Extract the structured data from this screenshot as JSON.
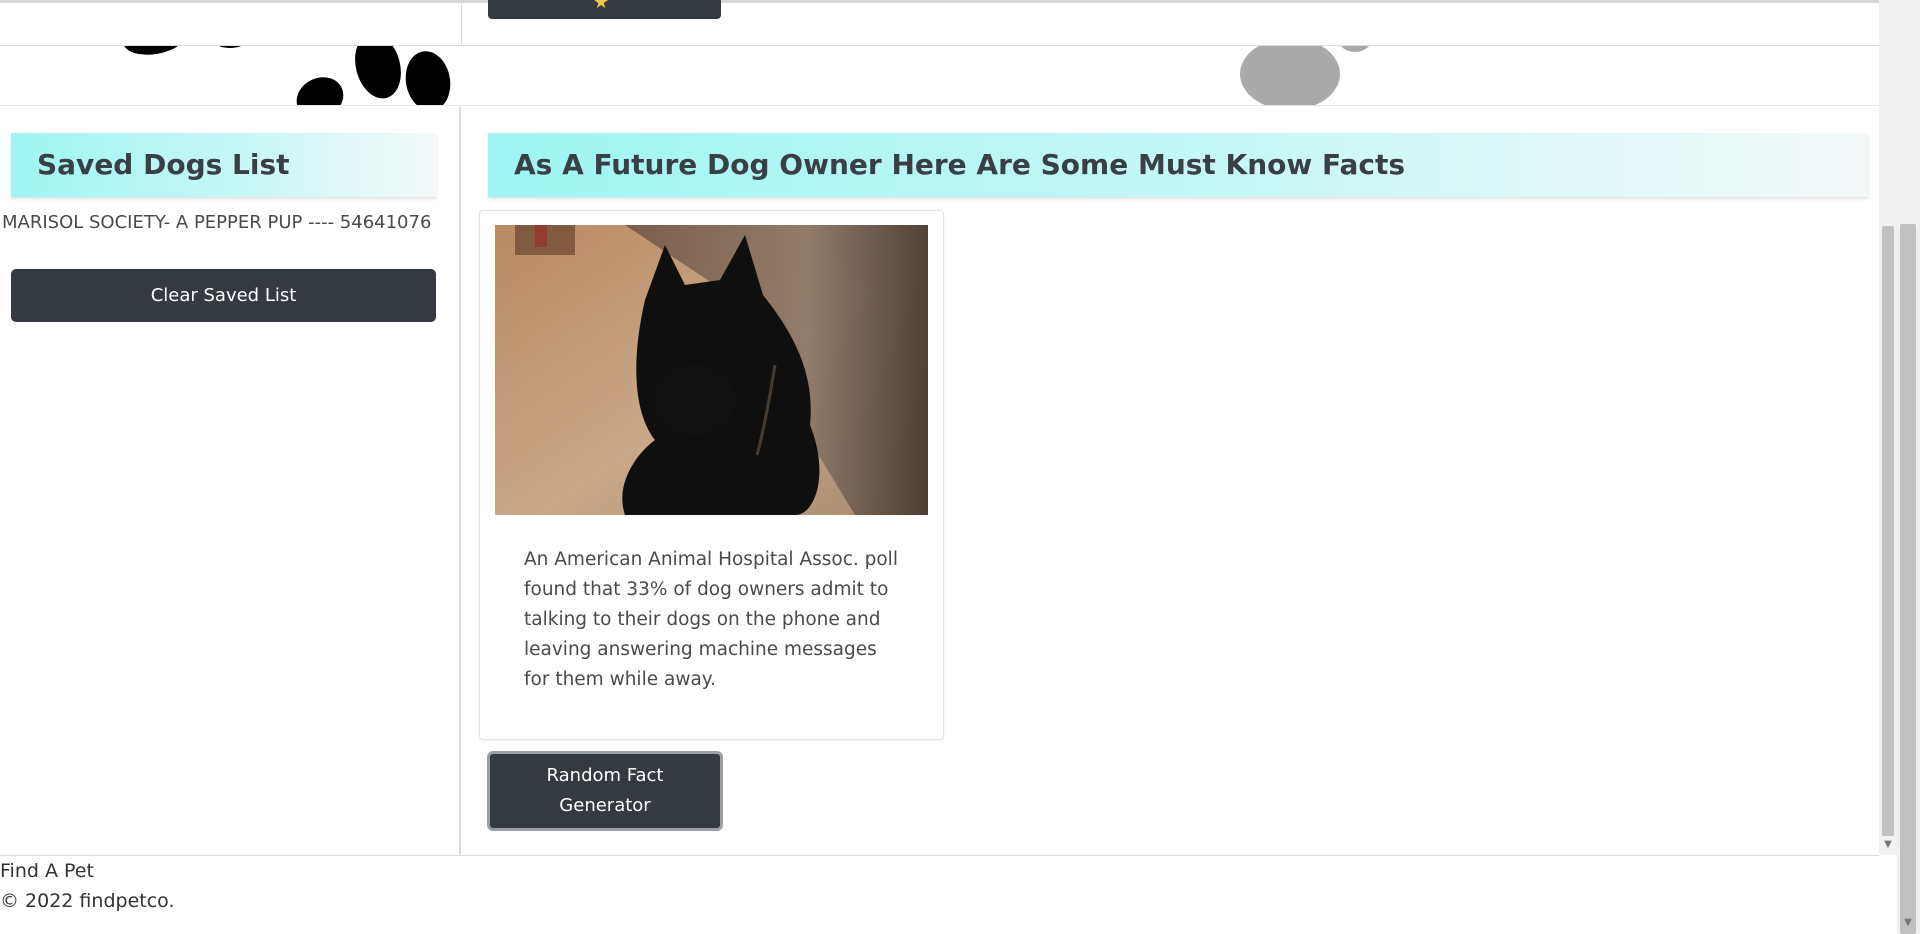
{
  "top": {
    "star_icon": "star-icon"
  },
  "saved": {
    "heading": "Saved Dogs List",
    "items": [
      "MARISOL SOCIETY- A PEPPER PUP ---- 54641076"
    ],
    "clear_label": "Clear Saved List"
  },
  "facts": {
    "heading": "As A Future Dog Owner Here Are Some Must Know Facts",
    "text": "An American Animal Hospital Assoc. poll found that 33% of dog owners admit to talking to their dogs on the phone and leaving answering machine messages for them while away.",
    "button_label": "Random Fact Generator"
  },
  "footer": {
    "brand": "Find A Pet",
    "copyright": "© 2022 findpetco."
  },
  "colors": {
    "header_gradient_start": "#9ef5f2",
    "button_dark": "#343a40"
  }
}
